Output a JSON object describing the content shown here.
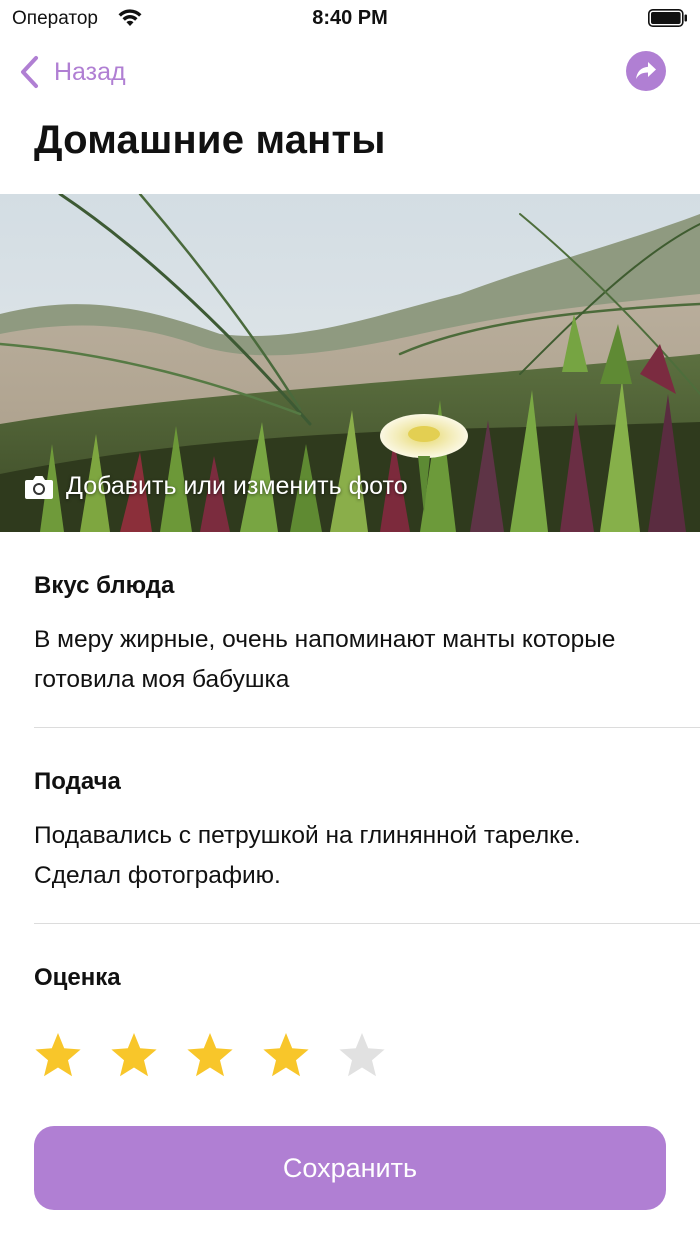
{
  "status_bar": {
    "carrier": "Оператор",
    "time": "8:40 PM"
  },
  "nav": {
    "back_label": "Назад",
    "back_icon": "chevron-left-icon",
    "share_icon": "share-arrow-icon"
  },
  "page_title": "Домашние манты",
  "photo": {
    "action_label": "Добавить или изменить фото",
    "action_icon": "camera-icon"
  },
  "sections": [
    {
      "title": "Вкус блюда",
      "text": "В меру жирные, очень напоминают манты которые готовила моя бабушка"
    },
    {
      "title": "Подача",
      "text": "Подавались с петрушкой на глинянной тарелке. Сделал фотографию."
    }
  ],
  "rating": {
    "title": "Оценка",
    "value": 4,
    "max": 5
  },
  "save_button": {
    "label": "Сохранить"
  },
  "colors": {
    "accent": "#b07fd3",
    "star_filled": "#f8c62a",
    "star_empty": "#e1e1e1"
  }
}
